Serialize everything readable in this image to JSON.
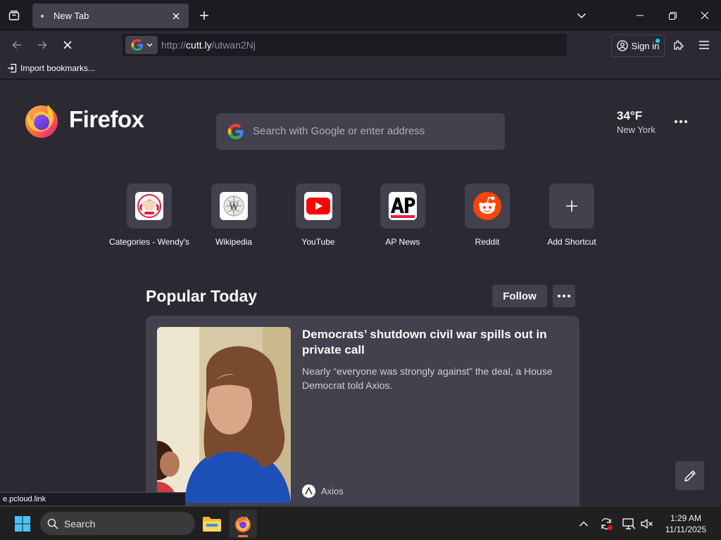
{
  "tabs": [
    {
      "title": "New Tab"
    }
  ],
  "urlbar": {
    "scheme": "http://",
    "domain": "cutt.ly",
    "path": "/utwan2Nj"
  },
  "account": {
    "signin_label": "Sign in"
  },
  "bookmarks": {
    "import_label": "Import bookmarks..."
  },
  "newtab": {
    "brand": "Firefox",
    "search_placeholder": "Search with Google or enter address",
    "weather": {
      "temp": "34°F",
      "city": "New York"
    },
    "shortcuts": [
      {
        "label": "Categories - Wendy's",
        "icon": "wendys-icon"
      },
      {
        "label": "Wikipedia",
        "icon": "wikipedia-icon"
      },
      {
        "label": "YouTube",
        "icon": "youtube-icon"
      },
      {
        "label": "AP News",
        "icon": "ap-news-icon"
      },
      {
        "label": "Reddit",
        "icon": "reddit-icon"
      },
      {
        "label": "Add Shortcut",
        "icon": "plus-icon"
      }
    ],
    "popular": {
      "title": "Popular Today",
      "follow_label": "Follow",
      "story": {
        "title": "Democrats’ shutdown civil war spills out in private call",
        "excerpt": "Nearly “everyone was strongly against” the deal, a House Democrat told Axios.",
        "source": "Axios"
      }
    }
  },
  "status_text": "e.pcloud.link",
  "taskbar": {
    "search_label": "Search",
    "time": "1:29 AM",
    "date": "11/11/2025"
  },
  "colors": {
    "accent": "#00ddff",
    "firefox_orange": "#ff7139",
    "youtube_red": "#ff0000",
    "reddit_orange": "#ff4500"
  }
}
